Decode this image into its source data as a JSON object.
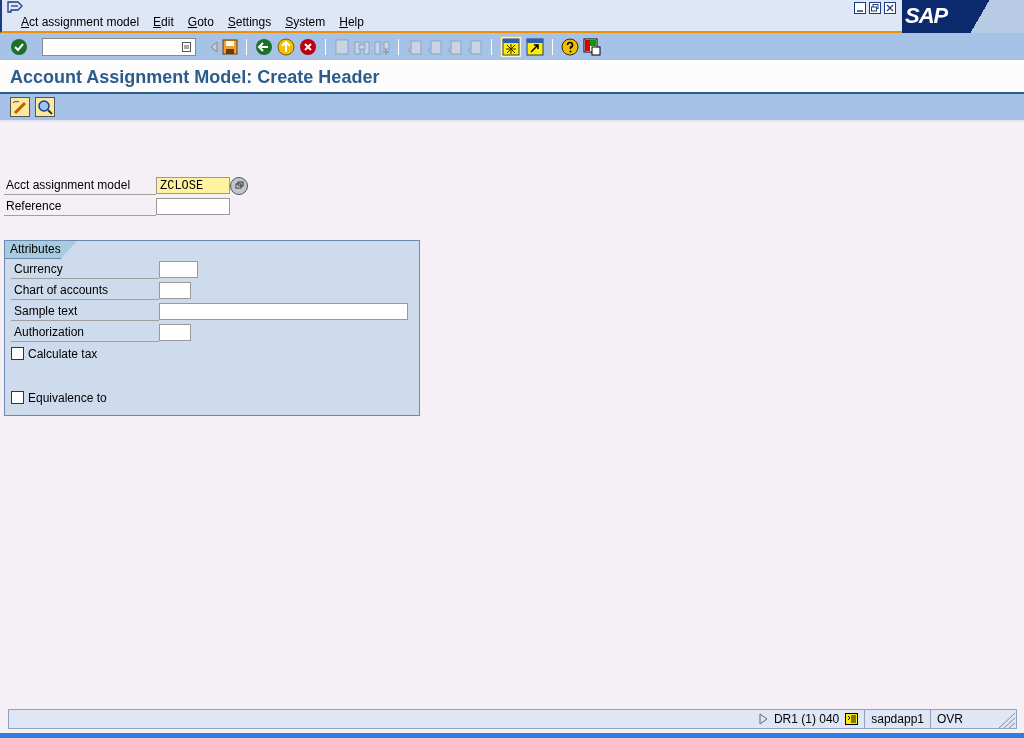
{
  "menu": [
    {
      "label": "Act assignment model"
    },
    {
      "label": "Edit"
    },
    {
      "label": "Goto"
    },
    {
      "label": "Settings"
    },
    {
      "label": "System"
    },
    {
      "label": "Help"
    }
  ],
  "logo": "SAP",
  "title": "Account Assignment Model: Create Header",
  "header_fields": [
    {
      "label": "Acct assignment model",
      "value": "ZCLOSE",
      "kind": "required"
    },
    {
      "label": "Reference",
      "kind": "text"
    }
  ],
  "attributes": {
    "title": "Attributes",
    "fields": [
      {
        "label": "Currency"
      },
      {
        "label": "Chart of accounts"
      },
      {
        "label": "Sample text"
      },
      {
        "label": "Authorization"
      }
    ],
    "checkboxes": [
      {
        "label": "Calculate tax",
        "checked": false
      },
      {
        "label": "Equivalence to",
        "checked": false
      }
    ]
  },
  "status_bar": {
    "system": "DR1 (1) 040",
    "server": "sapdapp1",
    "mode": "OVR"
  }
}
